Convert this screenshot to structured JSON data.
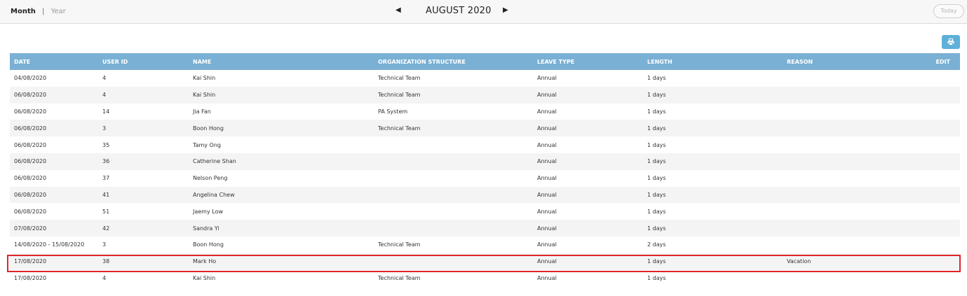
{
  "toolbar": {
    "month_label": "Month",
    "separator": "|",
    "year_label": "Year",
    "prev_icon": "triangle-left",
    "period_title": "AUGUST 2020",
    "next_icon": "triangle-right",
    "today_label": "Today"
  },
  "actions": {
    "print_icon": "printer-icon",
    "print_color": "#5fb0d9"
  },
  "table": {
    "header_color": "#79b0d3",
    "columns": [
      "DATE",
      "USER ID",
      "NAME",
      "ORGANIZATION STRUCTURE",
      "LEAVE TYPE",
      "LENGTH",
      "REASON",
      "EDIT"
    ],
    "rows": [
      [
        "04/08/2020",
        "4",
        "Kai Shin",
        "Technical Team",
        "Annual",
        "1 days",
        "",
        ""
      ],
      [
        "06/08/2020",
        "4",
        "Kai Shin",
        "Technical Team",
        "Annual",
        "1 days",
        "",
        ""
      ],
      [
        "06/08/2020",
        "14",
        "Jia Fan",
        "PA System",
        "Annual",
        "1 days",
        "",
        ""
      ],
      [
        "06/08/2020",
        "3",
        "Boon Hong",
        "Technical Team",
        "Annual",
        "1 days",
        "",
        ""
      ],
      [
        "06/08/2020",
        "35",
        "Tamy Ong",
        "",
        "Annual",
        "1 days",
        "",
        ""
      ],
      [
        "06/08/2020",
        "36",
        "Catherine Shan",
        "",
        "Annual",
        "1 days",
        "",
        ""
      ],
      [
        "06/08/2020",
        "37",
        "Nelson Peng",
        "",
        "Annual",
        "1 days",
        "",
        ""
      ],
      [
        "06/08/2020",
        "41",
        "Angelina Chew",
        "",
        "Annual",
        "1 days",
        "",
        ""
      ],
      [
        "06/08/2020",
        "51",
        "Jaemy Low",
        "",
        "Annual",
        "1 days",
        "",
        ""
      ],
      [
        "07/08/2020",
        "42",
        "Sandra Yi",
        "",
        "Annual",
        "1 days",
        "",
        ""
      ],
      [
        "14/08/2020 - 15/08/2020",
        "3",
        "Boon Hong",
        "Technical Team",
        "Annual",
        "2 days",
        "",
        ""
      ],
      [
        "17/08/2020",
        "38",
        "Mark Ho",
        "",
        "Annual",
        "1 days",
        "Vacation",
        ""
      ],
      [
        "17/08/2020",
        "4",
        "Kai Shin",
        "Technical Team",
        "Annual",
        "1 days",
        "",
        ""
      ]
    ],
    "highlight_color": "#e0242a"
  }
}
